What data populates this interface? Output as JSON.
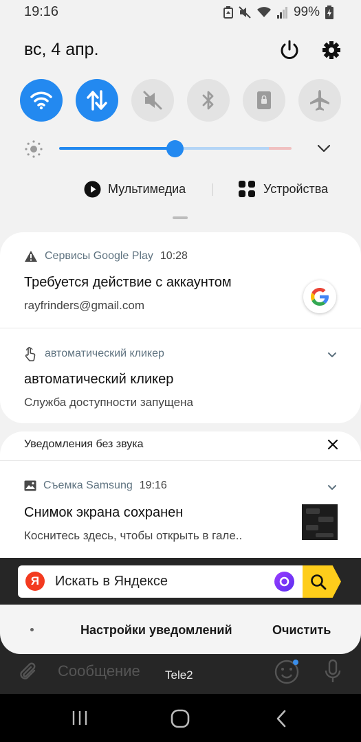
{
  "status_bar": {
    "time": "19:16",
    "battery_percent": "99%",
    "icons": [
      "battery-saver-icon",
      "mute-icon",
      "wifi-icon",
      "cellular-signal-icon",
      "battery-charging-icon"
    ]
  },
  "header": {
    "date": "вс, 4 апр.",
    "icons": [
      "power-icon",
      "settings-icon"
    ]
  },
  "quick_toggles": [
    {
      "name": "wifi",
      "icon": "wifi-icon",
      "state": "on"
    },
    {
      "name": "mobile-data",
      "icon": "data-arrows-icon",
      "state": "on"
    },
    {
      "name": "sound",
      "icon": "mute-icon",
      "state": "off"
    },
    {
      "name": "bluetooth",
      "icon": "bluetooth-icon",
      "state": "off"
    },
    {
      "name": "rotation-lock",
      "icon": "portrait-lock-icon",
      "state": "off"
    },
    {
      "name": "airplane-mode",
      "icon": "airplane-icon",
      "state": "off"
    }
  ],
  "brightness": {
    "level": 0.43,
    "accent_color": "#2389f0"
  },
  "media_row": {
    "media_label": "Мультимедиа",
    "devices_label": "Устройства"
  },
  "notifications": {
    "google": {
      "app_name": "Сервисы Google Play",
      "time": "10:28",
      "title": "Требуется действие с аккаунтом",
      "text": "rayfrinders@gmail.com"
    },
    "clicker": {
      "app_name": "автоматический кликер",
      "title": "автоматический кликер",
      "text": "Служба доступности запущена"
    },
    "silent_header": "Уведомления без звука",
    "screenshot": {
      "app_name": "Съемка Samsung",
      "time": "19:16",
      "title": "Снимок экрана сохранен",
      "text": "Коснитесь здесь, чтобы открыть в гале.."
    }
  },
  "background_app": {
    "yandex_logo": "Я",
    "search_placeholder": "Искать в Яндексе",
    "message_placeholder": "Сообщение",
    "carrier": "Tele2"
  },
  "footer": {
    "settings_label": "Настройки уведомлений",
    "clear_label": "Очистить"
  },
  "nav": {
    "icons": [
      "recents-icon",
      "home-icon",
      "back-icon"
    ]
  }
}
